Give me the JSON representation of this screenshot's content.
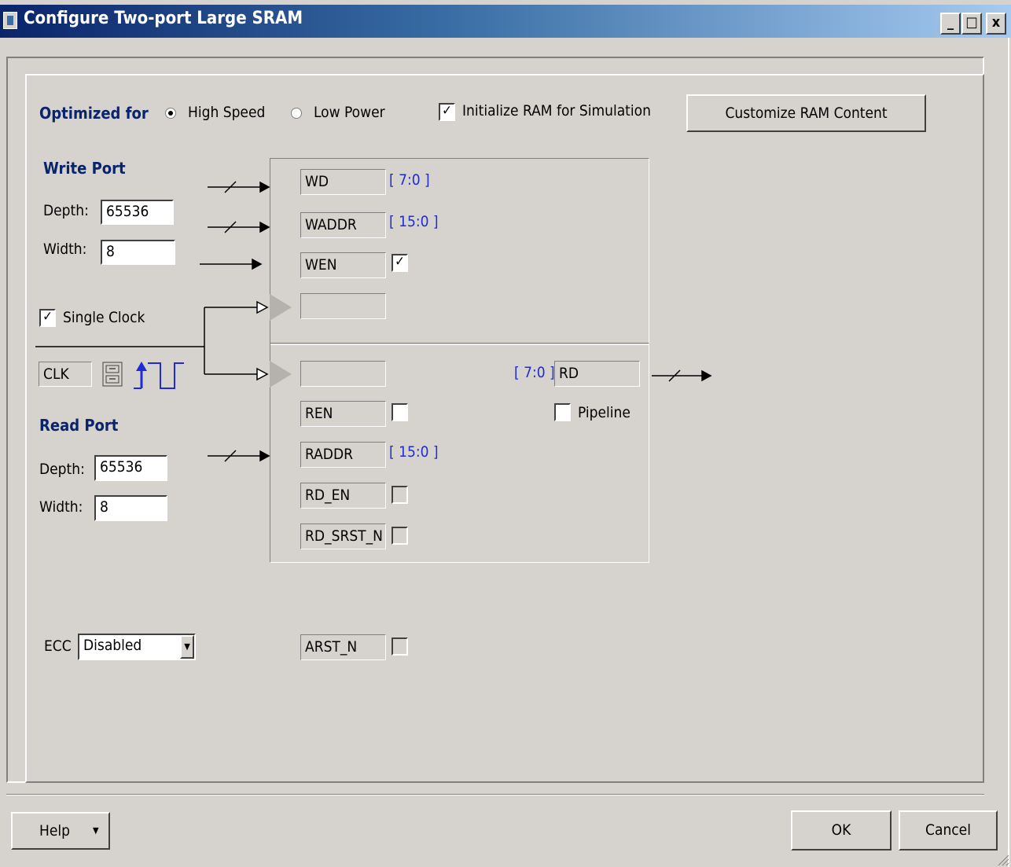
{
  "window": {
    "title": "Configure Two-port Large SRAM",
    "controls": [
      "_",
      "□",
      "x"
    ]
  },
  "options": {
    "optimized_label": "Optimized for",
    "high_speed_label": "High Speed",
    "high_speed_selected": true,
    "low_power_label": "Low Power",
    "low_power_selected": false,
    "init_ram_label": "Initialize RAM for Simulation",
    "init_ram_checked": true,
    "customize_label": "Customize RAM Content"
  },
  "write_port": {
    "title": "Write Port",
    "depth_label": "Depth:",
    "depth_value": "65536",
    "width_label": "Width:",
    "width_value": "8"
  },
  "clock": {
    "single_clock_label": "Single Clock",
    "single_clock_checked": true,
    "clk_label": "CLK"
  },
  "read_port": {
    "title": "Read  Port",
    "depth_label": "Depth:",
    "depth_value": "65536",
    "width_label": "Width:",
    "width_value": "8"
  },
  "ecc": {
    "label": "ECC",
    "value": "Disabled"
  },
  "block": {
    "wd": "WD",
    "wd_bits": "[ 7:0 ]",
    "waddr": "WADDR",
    "waddr_bits": "[ 15:0 ]",
    "wen": "WEN",
    "wen_checked": true,
    "wclk": "",
    "rclk": "",
    "rd": "RD",
    "rd_bits": "[ 7:0 ]",
    "pipeline_label": "Pipeline",
    "pipeline_checked": false,
    "ren": "REN",
    "ren_checked": false,
    "raddr": "RADDR",
    "raddr_bits": "[ 15:0 ]",
    "rd_en": "RD_EN",
    "rd_srst_n": "RD_SRST_N",
    "arst_n": "ARST_N"
  },
  "footer": {
    "help_label": "Help",
    "ok_label": "OK",
    "cancel_label": "Cancel"
  }
}
